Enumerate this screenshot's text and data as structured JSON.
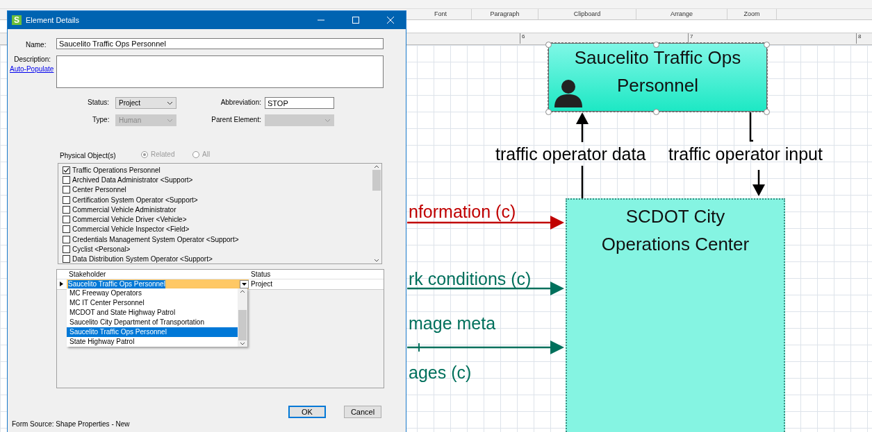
{
  "ribbon_groups": [
    "Font",
    "Paragraph",
    "Clipboard",
    "Arrange",
    "Zoom"
  ],
  "ruler_marks": [
    "6",
    "7",
    "8"
  ],
  "diagram": {
    "nodes": [
      {
        "kind": "human",
        "label": "Saucelito Traffic Ops Personnel",
        "selected": true
      },
      {
        "kind": "center",
        "label": "SCDOT City Operations Center",
        "selected": false
      }
    ],
    "flows": [
      {
        "label": "traffic operator data",
        "color": "#000000"
      },
      {
        "label": "traffic operator input",
        "color": "#000000"
      },
      {
        "label": "nformation (c)",
        "color": "#c00000"
      },
      {
        "label": "rk conditions (c)",
        "color": "#00705c"
      },
      {
        "label": "mage meta",
        "color": "#00705c"
      },
      {
        "label": "ages (c)",
        "color": "#00705c"
      }
    ]
  },
  "dialog": {
    "app_icon_letter": "S",
    "title": "Element Details",
    "name": {
      "label": "Name:",
      "value": "Saucelito Traffic Ops Personnel"
    },
    "description": {
      "label": "Description:",
      "link": "Auto-Populate"
    },
    "status": {
      "label": "Status:",
      "value": "Project",
      "disabled": false
    },
    "abbreviation": {
      "label": "Abbreviation:",
      "value": "STOP"
    },
    "type": {
      "label": "Type:",
      "value": "Human",
      "disabled": true
    },
    "parent_element": {
      "label": "Parent Element:",
      "disabled": true
    },
    "physical_objects": {
      "label": "Physical Object(s)",
      "radios": [
        {
          "label": "Related",
          "selected": true,
          "disabled": true
        },
        {
          "label": "All",
          "selected": false,
          "disabled": true
        }
      ],
      "items": [
        {
          "label": "Traffic Operations Personnel",
          "checked": true
        },
        {
          "label": "Archived Data Administrator <Support>",
          "checked": false
        },
        {
          "label": "Center Personnel",
          "checked": false
        },
        {
          "label": "Certification System Operator <Support>",
          "checked": false
        },
        {
          "label": "Commercial Vehicle Administrator",
          "checked": false
        },
        {
          "label": "Commercial Vehicle Driver <Vehicle>",
          "checked": false
        },
        {
          "label": "Commercial Vehicle Inspector <Field>",
          "checked": false
        },
        {
          "label": "Credentials Management System Operator <Support>",
          "checked": false
        },
        {
          "label": "Cyclist <Personal>",
          "checked": false
        },
        {
          "label": "Data Distribution System Operator <Support>",
          "checked": false
        }
      ]
    },
    "stakeholders": {
      "columns": [
        "Stakeholder",
        "Status"
      ],
      "rows": [
        {
          "stakeholder": "Saucelito Traffic Ops Personnel",
          "status": "Project"
        }
      ],
      "dropdown_options": [
        {
          "label": "MC Freeway Operators",
          "selected": false
        },
        {
          "label": "MC IT Center Personnel",
          "selected": false
        },
        {
          "label": "MCDOT and State Highway Patrol",
          "selected": false
        },
        {
          "label": "Saucelito City Department of Transportation",
          "selected": false
        },
        {
          "label": "Saucelito Traffic Ops Personnel",
          "selected": true
        },
        {
          "label": "State Highway Patrol",
          "selected": false
        }
      ]
    },
    "buttons": [
      {
        "label": "OK",
        "default": true
      },
      {
        "label": "Cancel",
        "default": false
      }
    ],
    "footer": "Form Source: Shape Properties - New"
  }
}
